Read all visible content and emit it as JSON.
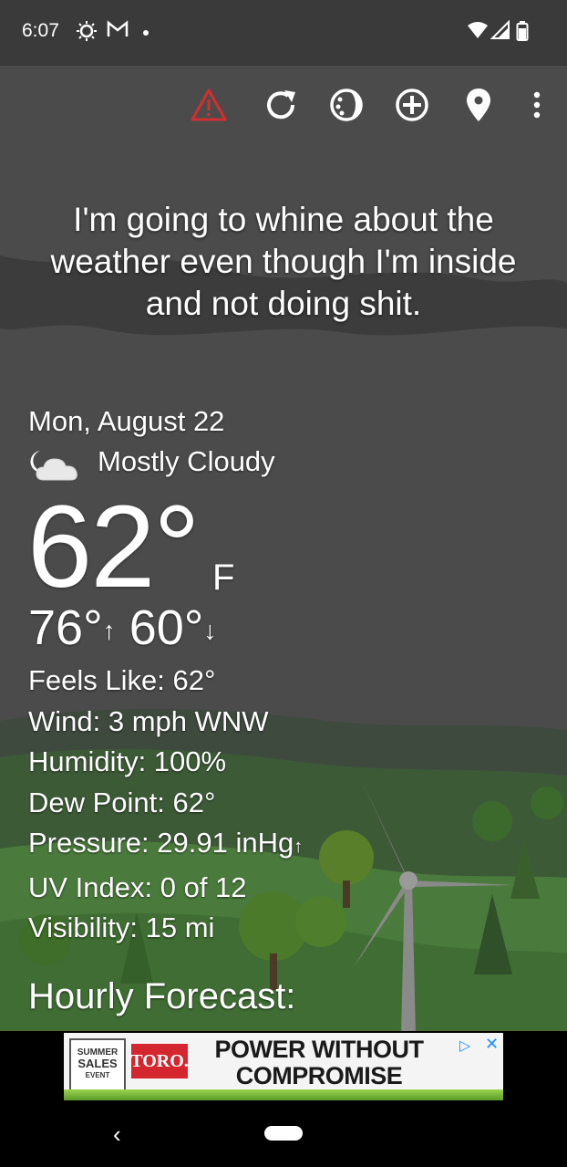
{
  "status_bar": {
    "time": "6:07",
    "icons": [
      "weather-sun-icon",
      "gmail-icon",
      "dot-icon",
      "wifi-icon",
      "signal-icon",
      "battery-icon"
    ]
  },
  "toolbar": {
    "icons": [
      "alert-warning-icon",
      "refresh-icon",
      "theme-icon",
      "add-location-icon",
      "location-pin-icon",
      "more-vert-icon"
    ],
    "warning_color": "#d32f2f"
  },
  "quote": "I'm going to whine about the weather even though I'm inside and not doing shit.",
  "current": {
    "date": "Mon, August 22",
    "condition_icon": "moon-cloud-icon",
    "condition": "Mostly Cloudy",
    "temperature": "62°",
    "unit": "F",
    "high": "76°",
    "low": "60°",
    "up_arrow": "↑",
    "down_arrow": "↓"
  },
  "details": {
    "feels_like": "Feels Like:  62°",
    "wind": "Wind:  3 mph WNW",
    "humidity": "Humidity:  100%",
    "dew_point": "Dew Point:  62°",
    "pressure": "Pressure:  29.91 inHg",
    "pressure_trend": "↑",
    "uv_index": "UV Index:  0 of 12",
    "visibility": "Visibility:  15 mi"
  },
  "hourly_heading": "Hourly Forecast:",
  "ad": {
    "badge_line1": "SUMMER",
    "badge_line2": "SALES",
    "badge_line3": "EVENT",
    "brand": "TORO.",
    "headline_line1": "POWER WITHOUT",
    "headline_line2": "COMPROMISE",
    "adchoices": "▷",
    "close": "✕"
  },
  "nav": {
    "back": "‹"
  }
}
